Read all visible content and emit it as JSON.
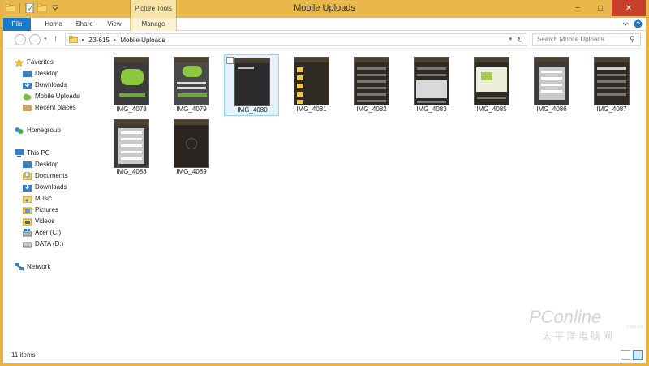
{
  "window": {
    "title": "Mobile Uploads",
    "context_tab_group": "Picture Tools",
    "controls": {
      "minimize": "−",
      "maximize": "□",
      "close": "✕"
    }
  },
  "ribbon": {
    "tabs": [
      {
        "label": "File"
      },
      {
        "label": "Home"
      },
      {
        "label": "Share"
      },
      {
        "label": "View"
      },
      {
        "label": "Manage"
      }
    ],
    "expand_icon": "chevron-down-icon",
    "help_icon": "help-icon"
  },
  "address_bar": {
    "back": "←",
    "forward": "→",
    "recent": "▾",
    "up": "↑",
    "breadcrumbs": [
      "Z3-615",
      "Mobile Uploads"
    ],
    "refresh": "↻"
  },
  "search": {
    "placeholder": "Search Mobile Uploads",
    "icon": "⚲"
  },
  "nav_pane": {
    "favorites": {
      "label": "Favorites",
      "items": [
        "Desktop",
        "Downloads",
        "Mobile Uploads",
        "Recent places"
      ]
    },
    "homegroup": {
      "label": "Homegroup"
    },
    "this_pc": {
      "label": "This PC",
      "items": [
        "Desktop",
        "Documents",
        "Downloads",
        "Music",
        "Pictures",
        "Videos",
        "Acer (C:)",
        "DATA (D:)"
      ]
    },
    "network": {
      "label": "Network"
    }
  },
  "files": [
    {
      "name": "IMG_4078",
      "selected": false,
      "style": "green"
    },
    {
      "name": "IMG_4079",
      "selected": false,
      "style": "green2"
    },
    {
      "name": "IMG_4080",
      "selected": true,
      "style": "dark"
    },
    {
      "name": "IMG_4081",
      "selected": false,
      "style": "folders"
    },
    {
      "name": "IMG_4082",
      "selected": false,
      "style": "list"
    },
    {
      "name": "IMG_4083",
      "selected": false,
      "style": "dialog"
    },
    {
      "name": "IMG_4085",
      "selected": false,
      "style": "photo"
    },
    {
      "name": "IMG_4086",
      "selected": false,
      "style": "menu"
    },
    {
      "name": "IMG_4087",
      "selected": false,
      "style": "list"
    },
    {
      "name": "IMG_4088",
      "selected": false,
      "style": "menu"
    },
    {
      "name": "IMG_4089",
      "selected": false,
      "style": "dark2"
    }
  ],
  "status": {
    "item_count": "11 items"
  },
  "watermark": {
    "brand": "PConline",
    "sub": "太平洋电脑网",
    "domain": ".com.cn"
  },
  "colors": {
    "title_bar": "#e8b84a",
    "file_tab": "#1979ca",
    "selection": "#e5f3ff",
    "close": "#c7402b"
  }
}
